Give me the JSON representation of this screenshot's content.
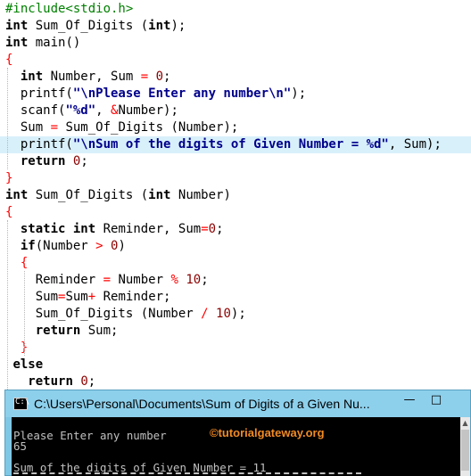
{
  "editor": {
    "lines": [
      {
        "tokens": [
          {
            "t": "#include<stdio.h>",
            "c": "pre"
          }
        ]
      },
      {
        "tokens": [
          {
            "t": "int",
            "c": "kw"
          },
          {
            "t": " Sum_Of_Digits ",
            "c": "plain"
          },
          {
            "t": "(",
            "c": "plain"
          },
          {
            "t": "int",
            "c": "kw"
          },
          {
            "t": ");",
            "c": "plain"
          }
        ]
      },
      {
        "tokens": [
          {
            "t": "int",
            "c": "kw"
          },
          {
            "t": " main()",
            "c": "plain"
          }
        ]
      },
      {
        "tokens": [
          {
            "t": "{",
            "c": "brace"
          }
        ]
      },
      {
        "tokens": [
          {
            "t": "  ",
            "c": "plain"
          },
          {
            "t": "int",
            "c": "kw"
          },
          {
            "t": " Number, Sum ",
            "c": "plain"
          },
          {
            "t": "=",
            "c": "op"
          },
          {
            "t": " ",
            "c": "plain"
          },
          {
            "t": "0",
            "c": "num"
          },
          {
            "t": ";",
            "c": "plain"
          }
        ]
      },
      {
        "tokens": [
          {
            "t": "  printf(",
            "c": "plain"
          },
          {
            "t": "\"\\nPlease Enter any number\\n\"",
            "c": "str"
          },
          {
            "t": ");",
            "c": "plain"
          }
        ]
      },
      {
        "tokens": [
          {
            "t": "  scanf(",
            "c": "plain"
          },
          {
            "t": "\"%d\"",
            "c": "str"
          },
          {
            "t": ", ",
            "c": "plain"
          },
          {
            "t": "&",
            "c": "op"
          },
          {
            "t": "Number);",
            "c": "plain"
          }
        ]
      },
      {
        "tokens": [
          {
            "t": "  Sum ",
            "c": "plain"
          },
          {
            "t": "=",
            "c": "op"
          },
          {
            "t": " Sum_Of_Digits (Number);",
            "c": "plain"
          }
        ]
      },
      {
        "highlight": true,
        "tokens": [
          {
            "t": "  printf(",
            "c": "plain"
          },
          {
            "t": "\"\\nSum of the digits of Given Number = %d\"",
            "c": "str"
          },
          {
            "t": ", Sum);",
            "c": "plain"
          }
        ]
      },
      {
        "tokens": [
          {
            "t": "  ",
            "c": "plain"
          },
          {
            "t": "return",
            "c": "kw"
          },
          {
            "t": " ",
            "c": "plain"
          },
          {
            "t": "0",
            "c": "num"
          },
          {
            "t": ";",
            "c": "plain"
          }
        ]
      },
      {
        "tokens": [
          {
            "t": "}",
            "c": "brace"
          }
        ]
      },
      {
        "tokens": [
          {
            "t": "int",
            "c": "kw"
          },
          {
            "t": " Sum_Of_Digits ",
            "c": "plain"
          },
          {
            "t": "(",
            "c": "plain"
          },
          {
            "t": "int",
            "c": "kw"
          },
          {
            "t": " Number)",
            "c": "plain"
          }
        ]
      },
      {
        "tokens": [
          {
            "t": "{",
            "c": "brace"
          }
        ]
      },
      {
        "tokens": [
          {
            "t": "  ",
            "c": "plain"
          },
          {
            "t": "static",
            "c": "kw"
          },
          {
            "t": " ",
            "c": "plain"
          },
          {
            "t": "int",
            "c": "kw"
          },
          {
            "t": " Reminder, Sum",
            "c": "plain"
          },
          {
            "t": "=",
            "c": "op"
          },
          {
            "t": "0",
            "c": "num"
          },
          {
            "t": ";",
            "c": "plain"
          }
        ]
      },
      {
        "tokens": [
          {
            "t": "  ",
            "c": "plain"
          },
          {
            "t": "if",
            "c": "kw"
          },
          {
            "t": "(Number ",
            "c": "plain"
          },
          {
            "t": ">",
            "c": "op"
          },
          {
            "t": " ",
            "c": "plain"
          },
          {
            "t": "0",
            "c": "num"
          },
          {
            "t": ")",
            "c": "plain"
          }
        ]
      },
      {
        "tokens": [
          {
            "t": "  ",
            "c": "plain"
          },
          {
            "t": "{",
            "c": "brace"
          }
        ]
      },
      {
        "tokens": [
          {
            "t": "    Reminder ",
            "c": "plain"
          },
          {
            "t": "=",
            "c": "op"
          },
          {
            "t": " Number ",
            "c": "plain"
          },
          {
            "t": "%",
            "c": "op"
          },
          {
            "t": " ",
            "c": "plain"
          },
          {
            "t": "10",
            "c": "num"
          },
          {
            "t": ";",
            "c": "plain"
          }
        ]
      },
      {
        "tokens": [
          {
            "t": "    Sum",
            "c": "plain"
          },
          {
            "t": "=",
            "c": "op"
          },
          {
            "t": "Sum",
            "c": "plain"
          },
          {
            "t": "+",
            "c": "op"
          },
          {
            "t": " Reminder;",
            "c": "plain"
          }
        ]
      },
      {
        "tokens": [
          {
            "t": "    Sum_Of_Digits (Number ",
            "c": "plain"
          },
          {
            "t": "/",
            "c": "op"
          },
          {
            "t": " ",
            "c": "plain"
          },
          {
            "t": "10",
            "c": "num"
          },
          {
            "t": ");",
            "c": "plain"
          }
        ]
      },
      {
        "tokens": [
          {
            "t": "    ",
            "c": "plain"
          },
          {
            "t": "return",
            "c": "kw"
          },
          {
            "t": " Sum;",
            "c": "plain"
          }
        ]
      },
      {
        "tokens": [
          {
            "t": "  ",
            "c": "plain"
          },
          {
            "t": "}",
            "c": "brace"
          }
        ]
      },
      {
        "tokens": [
          {
            "t": " ",
            "c": "plain"
          },
          {
            "t": "else",
            "c": "kw"
          }
        ]
      },
      {
        "tokens": [
          {
            "t": "   ",
            "c": "plain"
          },
          {
            "t": "return",
            "c": "kw"
          },
          {
            "t": " ",
            "c": "plain"
          },
          {
            "t": "0",
            "c": "num"
          },
          {
            "t": ";",
            "c": "plain"
          }
        ]
      }
    ]
  },
  "console": {
    "title": "C:\\Users\\Personal\\Documents\\Sum of Digits of a Given Nu...",
    "icon_text": "C:\\",
    "minimize_label": "—",
    "maximize_label": "□",
    "watermark": "©tutorialgateway.org",
    "output": [
      "Please Enter any number",
      "65",
      "",
      "Sum of the digits of Given Number = 11"
    ],
    "scroll_up_label": "▲"
  },
  "colors": {
    "preprocessor": "#008000",
    "string": "#00008b",
    "operator": "#ff0000",
    "number": "#8b0000",
    "highlight": "#d8f0fa",
    "console_bg": "#000000",
    "titlebar": "#8dd0ec"
  }
}
